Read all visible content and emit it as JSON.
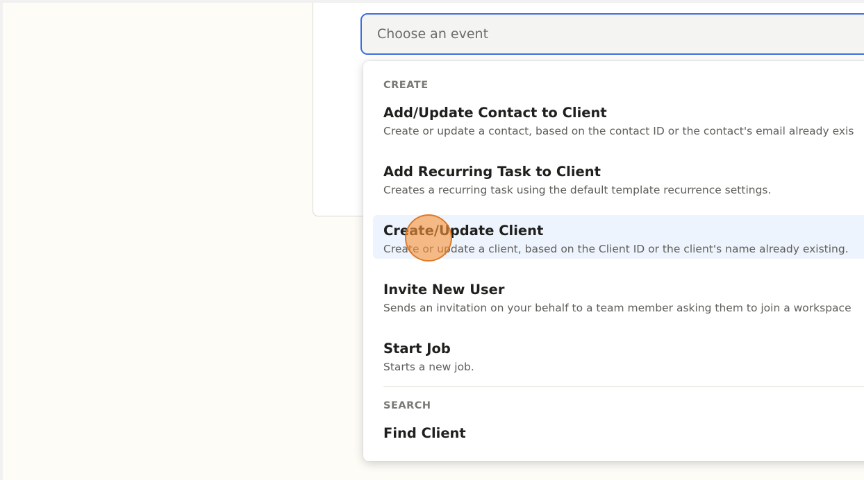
{
  "select": {
    "placeholder": "Choose an event"
  },
  "dropdown": {
    "sections": [
      {
        "header": "CREATE",
        "options": [
          {
            "title": "Add/Update Contact to Client",
            "description": "Create or update a contact, based on the contact ID or the contact's email already exis"
          },
          {
            "title": "Add Recurring Task to Client",
            "description": "Creates a recurring task using the default template recurrence settings."
          },
          {
            "title": "Create/Update Client",
            "description": "Create or update a client, based on the Client ID or the client's name already existing.",
            "highlighted": true
          },
          {
            "title": "Invite New User",
            "description": "Sends an invitation on your behalf to a team member asking them to join a workspace"
          },
          {
            "title": "Start Job",
            "description": "Starts a new job."
          }
        ]
      },
      {
        "header": "SEARCH",
        "options": [
          {
            "title": "Find Client",
            "description": ""
          }
        ]
      }
    ]
  },
  "colors": {
    "focus_border": "#3d6fe0",
    "highlight_bg": "#eef4fd",
    "cursor_fill": "#f8953c",
    "page_bg": "#fdfcf7"
  }
}
